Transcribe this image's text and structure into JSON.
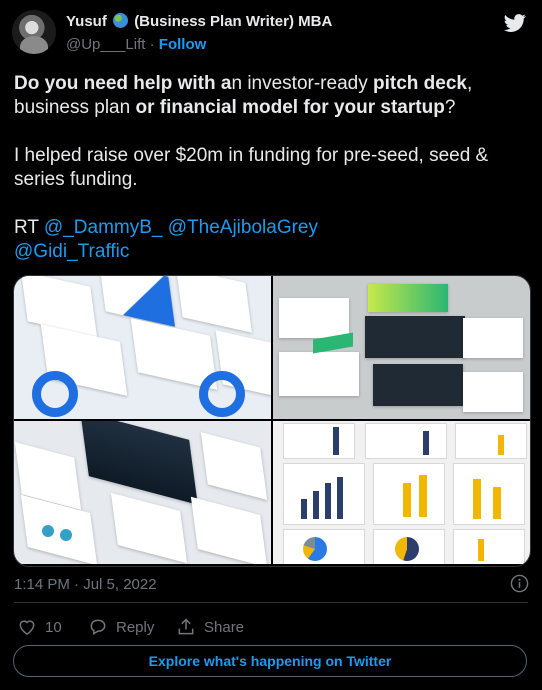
{
  "author": {
    "name_first": "Yusuf",
    "name_rest": "(Business Plan Writer) MBA",
    "handle": "@Up___Lift",
    "separator": "·",
    "follow_label": "Follow",
    "badge_icon": "globe-icon"
  },
  "tweet": {
    "segments": [
      {
        "text": "Do you need help with a",
        "bold": true
      },
      {
        "text": "n investor-ready ",
        "bold": false
      },
      {
        "text": "pitch deck",
        "bold": true
      },
      {
        "text": ",",
        "bold": false
      },
      {
        "text": "business plan",
        "bold": false
      },
      {
        "text": " or financial model for your startup",
        "bold": true
      },
      {
        "text": "?",
        "bold": false
      }
    ],
    "paragraph2": "I helped raise over $20m in funding for pre-seed, seed & series funding.",
    "rt_prefix": "RT",
    "mentions": [
      "@_DammyB_",
      "@TheAjibolaGrey",
      "@Gidi_Traffic"
    ]
  },
  "media": {
    "tiles": [
      "business-plan-slides",
      "dark-green-pitch-deck",
      "ocean-presentation-slides",
      "financial-model-charts"
    ]
  },
  "timestamp": "1:14 PM · Jul 5, 2022",
  "actions": {
    "like_count": "10",
    "reply_label": "Reply",
    "share_label": "Share"
  },
  "explore_label": "Explore what's happening on Twitter",
  "colors": {
    "background": "#000000",
    "text": "#e7e9ea",
    "muted": "#71767b",
    "accent": "#1d9bf0",
    "border": "#2f3336"
  }
}
